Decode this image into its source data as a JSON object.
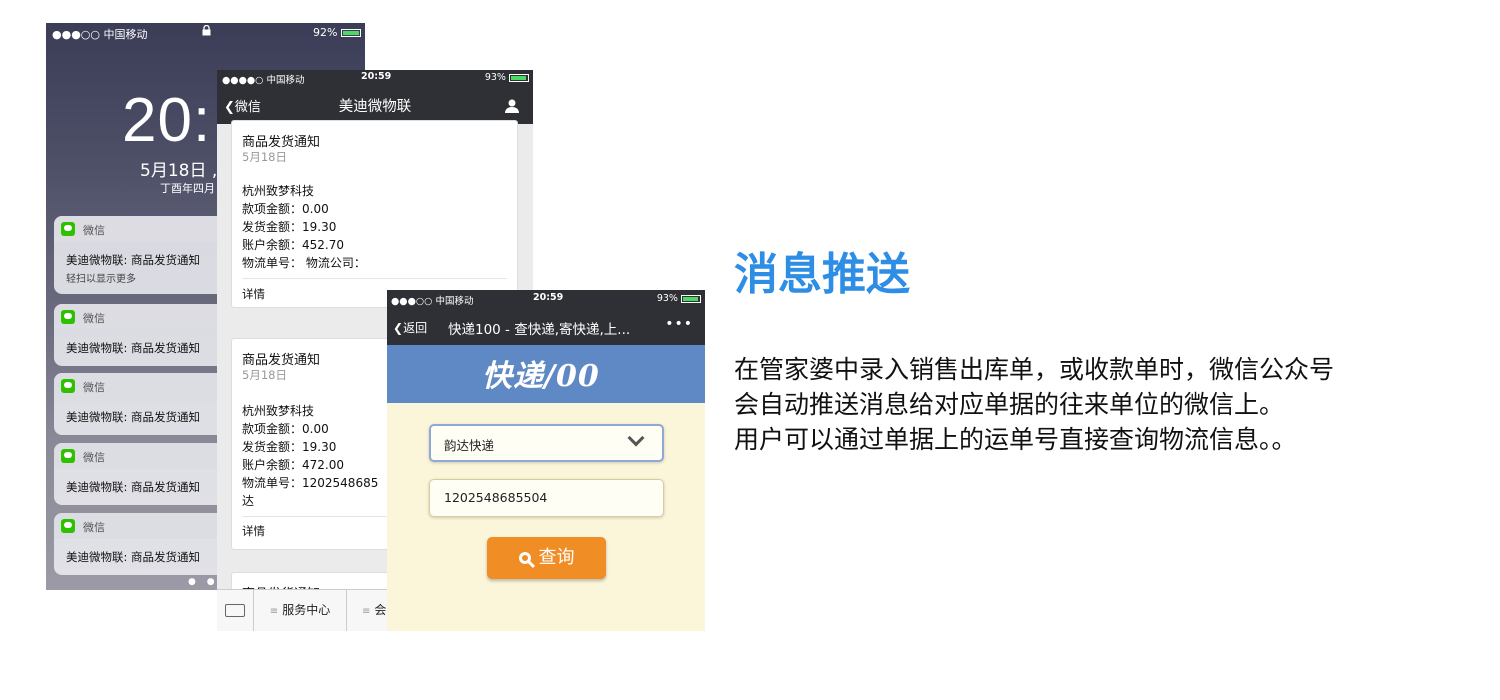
{
  "colors": {
    "accent": "#2e8de4",
    "wechat_green": "#2dc100",
    "kuaidi_blue": "#5f89c4",
    "query_orange": "#f08d25"
  },
  "lock_screen": {
    "status": {
      "carrier": "●●●○○ 中国移动",
      "battery": "92%"
    },
    "time": "20:",
    "date": "5月18日 ,",
    "lunar": "丁酉年四月",
    "notifications": [
      {
        "app": "微信",
        "text": "美迪微物联: 商品发货通知",
        "sub": "轻扫以显示更多"
      },
      {
        "app": "微信",
        "text": "美迪微物联: 商品发货通知"
      },
      {
        "app": "微信",
        "text": "美迪微物联: 商品发货通知"
      },
      {
        "app": "微信",
        "text": "美迪微物联: 商品发货通知"
      },
      {
        "app": "微信",
        "text": "美迪微物联: 商品发货通知"
      }
    ],
    "page_dots": "● ●"
  },
  "chat": {
    "status": {
      "carrier": "●●●●○ 中国移动",
      "time": "20:59",
      "battery": "93%"
    },
    "back_label": "微信",
    "title": "美迪微物联",
    "cards": [
      {
        "title": "商品发货通知",
        "date": "5月18日",
        "company": "杭州致梦科技",
        "payment": "款项金额：0.00",
        "shipping": "发货金额：19.30",
        "balance": "账户余额：452.70",
        "logistics": "物流单号：   物流公司：",
        "details": "详情"
      },
      {
        "title": "商品发货通知",
        "date": "5月18日",
        "company": "杭州致梦科技",
        "payment": "款项金额：0.00",
        "shipping": "发货金额：19.30",
        "balance": "账户余额：472.00",
        "logistics": "物流单号：1202548685",
        "logistics_cont": "达",
        "details": "详情"
      },
      {
        "title": "商品发货通知"
      }
    ],
    "bottom_menu": {
      "service": "服务中心",
      "member": "会"
    }
  },
  "kuaidi": {
    "status": {
      "carrier": "●●●○○ 中国移动",
      "time": "20:59",
      "battery": "93%"
    },
    "back_label": "返回",
    "title": "快递100 - 查快递,寄快递,上...",
    "more": "•••",
    "logo": "快递/00",
    "company_select": "韵达快递",
    "tracking_number": "1202548685504",
    "query_label": "查询"
  },
  "heading": "消息推送",
  "description": [
    "在管家婆中录入销售出库单，或收款单时，微信公众号",
    "会自动推送消息给对应单据的往来单位的微信上。",
    "用户可以通过单据上的运单号直接查询物流信息。。"
  ]
}
